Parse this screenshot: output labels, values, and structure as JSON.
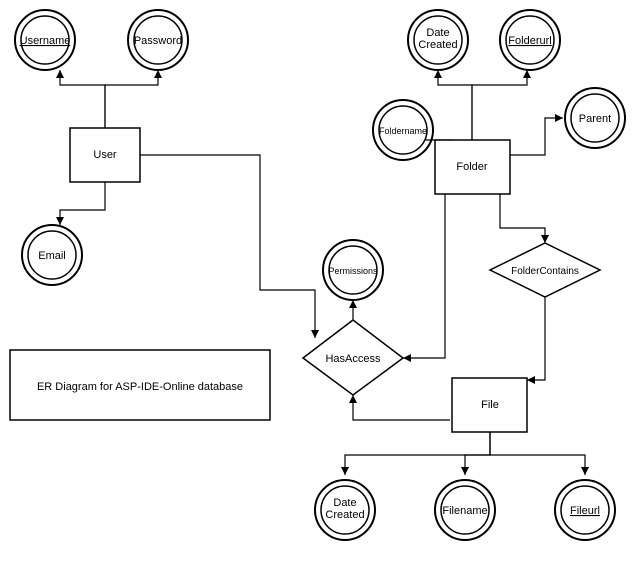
{
  "caption": "ER Diagram for ASP-IDE-Online database",
  "entities": {
    "user": {
      "label": "User"
    },
    "folder": {
      "label": "Folder"
    },
    "file": {
      "label": "File"
    }
  },
  "relationships": {
    "hasAccess": {
      "label": "HasAccess"
    },
    "folderContains": {
      "label": "FolderContains"
    }
  },
  "attributes": {
    "username": {
      "label": "Username",
      "key": true,
      "of": "user"
    },
    "password": {
      "label": "Password",
      "key": false,
      "of": "user"
    },
    "email": {
      "label": "Email",
      "key": false,
      "of": "user"
    },
    "foldername": {
      "label": "Foldername",
      "key": false,
      "of": "folder"
    },
    "folderDateCreated": {
      "label": "Date\nCreated",
      "key": false,
      "of": "folder"
    },
    "folderurl": {
      "label": "Folderurl",
      "key": true,
      "of": "folder"
    },
    "parent": {
      "label": "Parent",
      "key": false,
      "of": "folder"
    },
    "permissions": {
      "label": "Permissions",
      "key": false,
      "of": "hasAccess"
    },
    "fileDateCreated": {
      "label": "Date\nCreated",
      "key": false,
      "of": "file"
    },
    "filename": {
      "label": "Filename",
      "key": false,
      "of": "file"
    },
    "fileurl": {
      "label": "Fileurl",
      "key": true,
      "of": "file"
    }
  }
}
